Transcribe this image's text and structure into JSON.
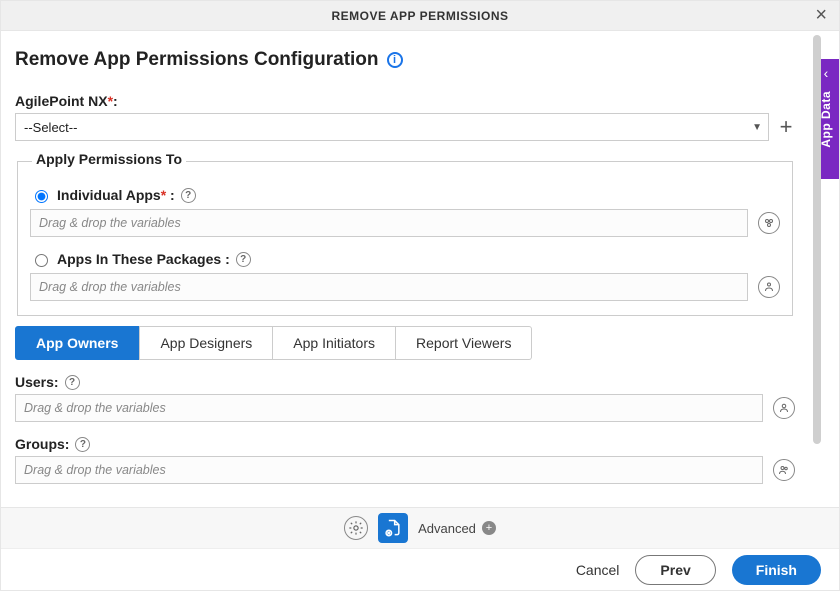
{
  "titlebar": {
    "title": "REMOVE APP PERMISSIONS"
  },
  "sidetab": {
    "label": "App Data"
  },
  "page": {
    "title": "Remove App Permissions Configuration"
  },
  "agilepoint": {
    "label": "AgilePoint NX",
    "selected": "--Select--"
  },
  "apply_to": {
    "legend": "Apply Permissions To",
    "individual": {
      "label": "Individual Apps",
      "checked": true,
      "placeholder": "Drag & drop the variables"
    },
    "packages": {
      "label": "Apps In These Packages :",
      "checked": false,
      "placeholder": "Drag & drop the variables"
    }
  },
  "tabs": {
    "0": {
      "label": "App Owners",
      "active": true
    },
    "1": {
      "label": "App Designers",
      "active": false
    },
    "2": {
      "label": "App Initiators",
      "active": false
    },
    "3": {
      "label": "Report Viewers",
      "active": false
    }
  },
  "users": {
    "label": "Users:",
    "placeholder": "Drag & drop the variables"
  },
  "groups": {
    "label": "Groups:",
    "placeholder": "Drag & drop the variables"
  },
  "toolbar": {
    "advanced": "Advanced"
  },
  "actions": {
    "cancel": "Cancel",
    "prev": "Prev",
    "finish": "Finish"
  }
}
